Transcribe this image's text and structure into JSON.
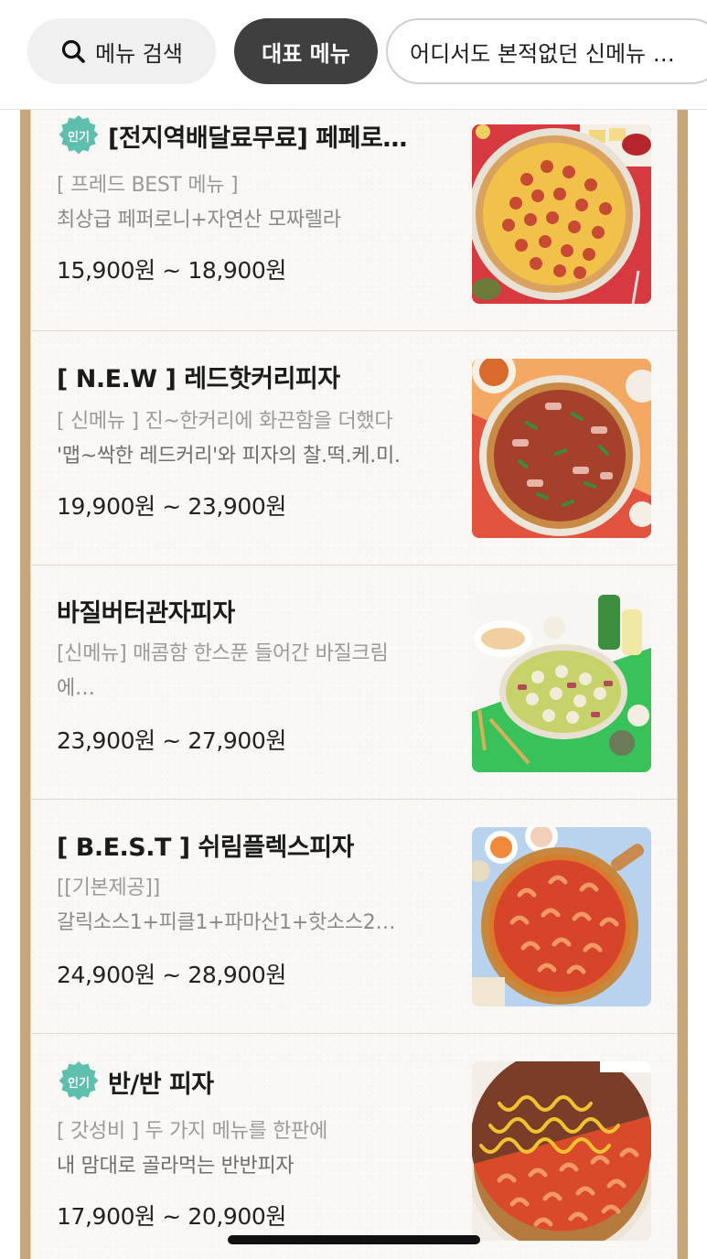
{
  "filters": {
    "search_label": "메뉴 검색",
    "active_label": "대표 메뉴",
    "next_label": "어디서도 본적없던 신메뉴 …"
  },
  "colors": {
    "frame": "#c6a57b",
    "badge": "#5fbfae",
    "active_chip": "#3f3f3f"
  },
  "menu": {
    "items": [
      {
        "badge": "인기",
        "title": "[전지역배달료무료] 페페로…",
        "desc_line1": "[ 프레드 BEST 메뉴 ]",
        "desc_line2": "최상급 페퍼로니+자연산 모짜렐라",
        "price": "15,900원 ~ 18,900원",
        "image": "pepperoni-pizza"
      },
      {
        "badge": "",
        "title": "[ N.E.W ] 레드핫커리피자",
        "desc_line1": "[ 신메뉴 ] 진~한커리에 화끈함을 더했다",
        "desc_line2": "'맵~싹한 레드커리'와 피자의 찰.떡.케.미.",
        "price": "19,900원 ~ 23,900원",
        "image": "red-hot-curry-pizza"
      },
      {
        "badge": "",
        "title": "바질버터관자피자",
        "desc_line1": "[신메뉴] 매콤함 한스푼 들어간 바질크림",
        "desc_line2": "에…",
        "price": "23,900원 ~ 27,900원",
        "image": "basil-butter-scallop-pizza"
      },
      {
        "badge": "",
        "title": "[ B.E.S.T ] 쉬림플렉스피자",
        "desc_line1": "[[기본제공]]",
        "desc_line2": "갈릭소스1+피클1+파마산1+핫소스2…",
        "price": "24,900원 ~ 28,900원",
        "image": "shrimplex-pizza"
      },
      {
        "badge": "인기",
        "title": "반/반 피자",
        "desc_line1": "[ 갓성비 ] 두 가지 메뉴를 한판에",
        "desc_line2": "내 맘대로 골라먹는 반반피자",
        "price": "17,900원 ~ 20,900원",
        "image": "half-half-pizza"
      }
    ]
  }
}
